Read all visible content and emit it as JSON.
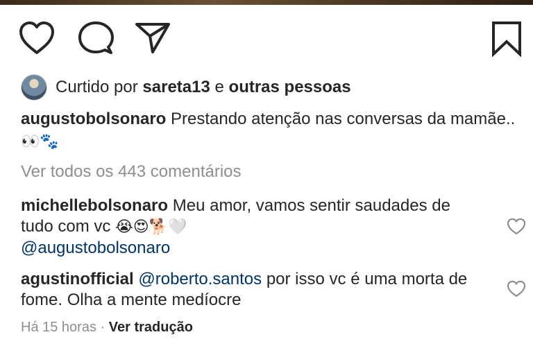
{
  "actions": {
    "like_icon": "heart-icon",
    "comment_icon": "comment-bubble-icon",
    "share_icon": "paper-plane-icon",
    "save_icon": "bookmark-icon"
  },
  "likes": {
    "prefix": "Curtido por",
    "user": "sareta13",
    "joiner": "e",
    "others": "outras pessoas"
  },
  "caption": {
    "username": "augustobolsonaro",
    "text": "Prestando atenção nas conversas da mamãe..",
    "emojis": "👀🐾"
  },
  "view_all_comments": "Ver todos os 443 comentários",
  "comments": [
    {
      "username": "michellebolsonaro",
      "text": "Meu amor, vamos sentir saudades de tudo com vc",
      "emojis": "😭😍🐕🤍",
      "mention": "@augustobolsonaro"
    },
    {
      "username": "agustinofficial",
      "mention": "@roberto.santos",
      "text": "por isso vc é uma morta de fome. Olha a mente medíocre"
    }
  ],
  "footer": {
    "time": "Há 15 horas",
    "separator": "·",
    "translate": "Ver tradução"
  },
  "colors": {
    "text": "#262626",
    "muted": "#8e8e8e",
    "mention": "#003569"
  }
}
